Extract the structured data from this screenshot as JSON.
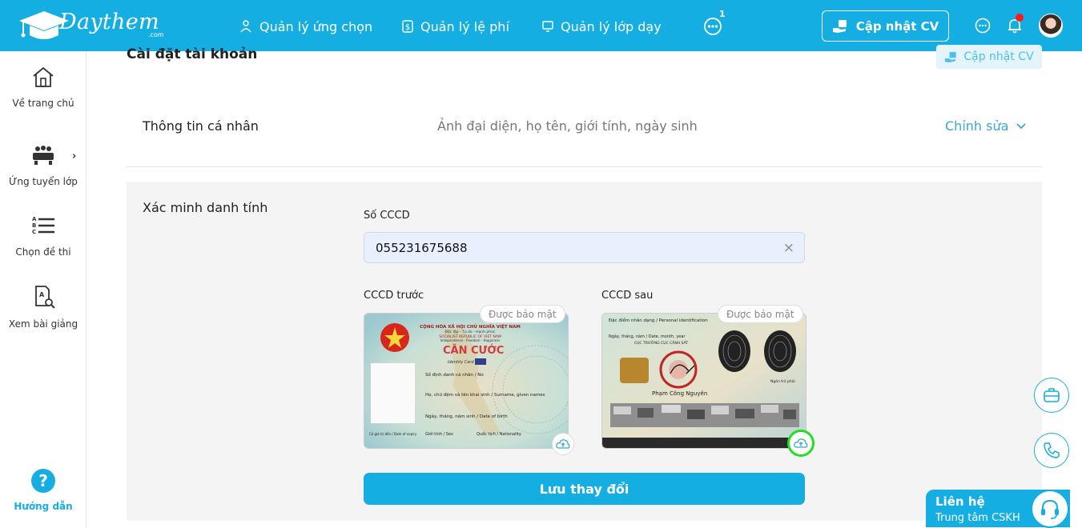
{
  "brand": {
    "name": "Daythem",
    "sub": ".com",
    "accent": "#15aee3"
  },
  "nav": {
    "applicants": "Quản lý ứng chọn",
    "fees": "Quản lý lệ phí",
    "classes": "Quản lý lớp dạy",
    "more_badge": "1",
    "update_cv": "Cập nhật CV"
  },
  "sidebar": {
    "home": "Về trang chủ",
    "apply": "Ứng tuyển lớp",
    "exam": "Chọn đề thi",
    "lessons": "Xem bài giảng",
    "help": "Hướng dẫn",
    "help_symbol": "?"
  },
  "page": {
    "title": "Cài đặt tài khoản",
    "ghost_cv": "Cập nhật CV",
    "personal": {
      "label": "Thông tin cá nhân",
      "desc": "Ảnh đại diện, họ tên, giới tính, ngày sinh",
      "edit": "Chỉnh sửa"
    },
    "verify": {
      "label": "Xác minh danh tính",
      "cccd_label": "Số CCCD",
      "cccd_value": "055231675688",
      "clear": "×",
      "front_label": "CCCD trước",
      "back_label": "CCCD sau",
      "secure_badge": "Được bảo mật",
      "save": "Lưu thay đổi"
    }
  },
  "card_front": {
    "header1": "CỘNG HÒA XÃ HỘI CHỦ NGHĨA VIỆT NAM",
    "header2": "Độc lập - Tự do - Hạnh phúc",
    "header3": "SOCIALIST REPUBLIC OF VIET NAM",
    "header4": "Independence - Freedom - Happiness",
    "title": "CĂN CƯỚC",
    "subtitle": "Identity Card",
    "line1": "Số định danh cá nhân / No",
    "line2": "Họ, chữ đệm và tên khai sinh / Surname, given names",
    "line3": "Ngày, tháng, năm sinh / Date of birth",
    "line4a": "Giới tính / Sex",
    "line4b": "Quốc tịch / Nationality",
    "line5": "Có giá trị đến / Date of expiry"
  },
  "card_back": {
    "header1": "Đặc điểm nhân dạng / Personal identification",
    "line2": "Ngày, tháng, năm / Date, month, year",
    "line3": "CỤC TRƯỞNG CỤC CẢNH SÁT",
    "right1": "Ngón trỏ trái",
    "right2": "Ngón trỏ phải",
    "name": "Phạm Công Nguyên"
  },
  "contact": {
    "title": "Liên hệ",
    "sub": "Trung tâm CSKH"
  }
}
